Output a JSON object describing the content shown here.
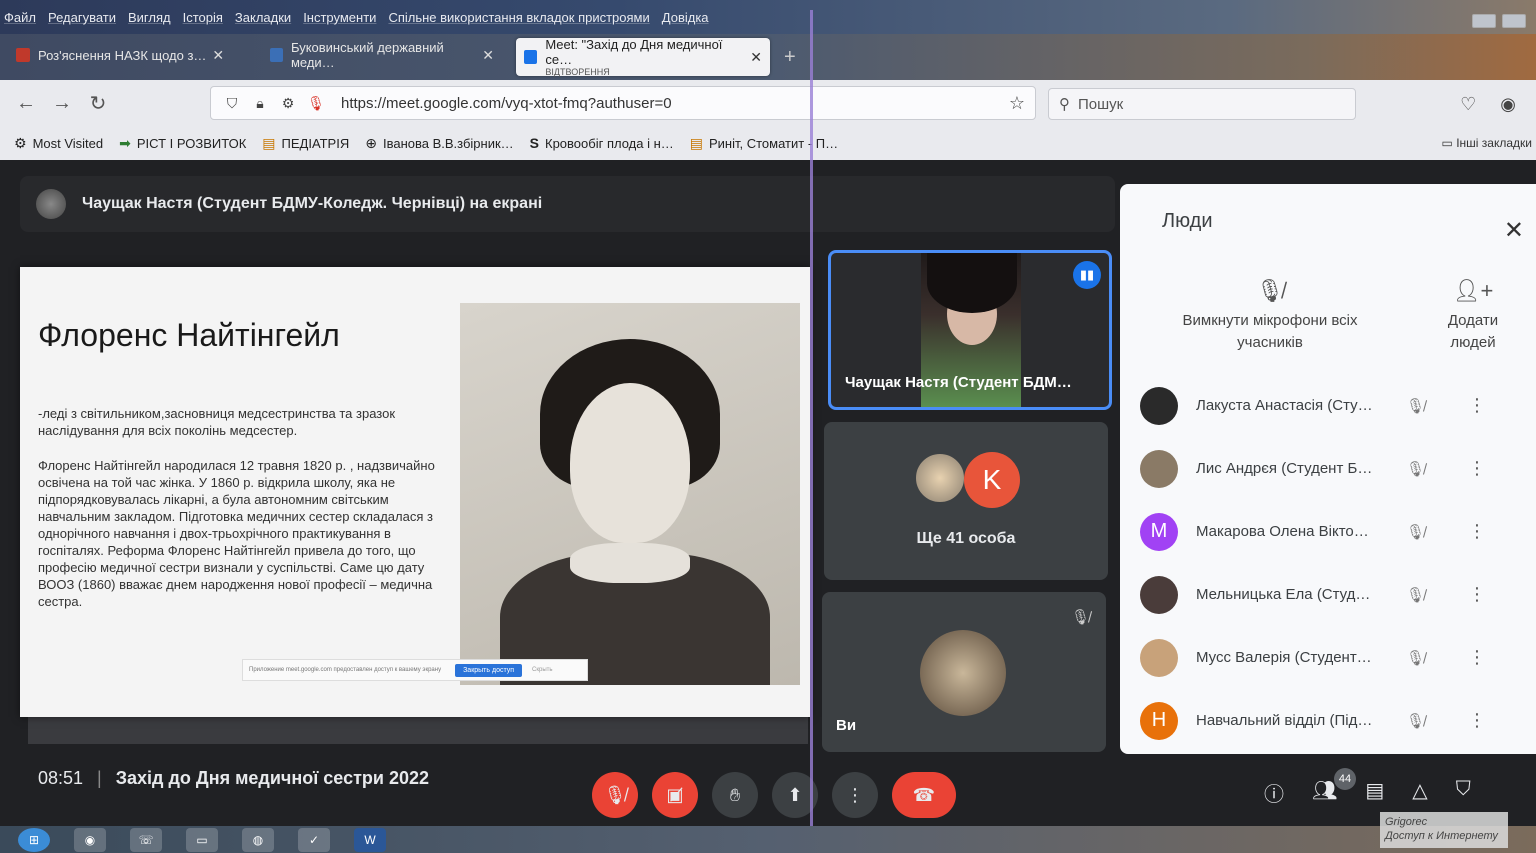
{
  "menu": [
    "Файл",
    "Редагувати",
    "Вигляд",
    "Історія",
    "Закладки",
    "Інструменти",
    "Спільне використання вкладок пристроями",
    "Довідка"
  ],
  "tabs": [
    {
      "label": "Роз'яснення НАЗК щодо з…",
      "favicon_color": "#c0392b"
    },
    {
      "label": "Буковинський державний меди…",
      "favicon_color": "#3b6fb6"
    },
    {
      "label": "Meet: \"Захід до Дня медичної се…",
      "sub": "ВІДТВОРЕННЯ",
      "favicon_color": "#1a73e8"
    }
  ],
  "url": "https://meet.google.com/vyq-xtot-fmq?authuser=0",
  "search_placeholder": "Пошук",
  "bookmarks": [
    {
      "label": "Most Visited",
      "icon": "gear-icon"
    },
    {
      "label": "РІСТ І РОЗВИТОК",
      "icon": "arrow-icon"
    },
    {
      "label": "ПЕДІАТРІЯ",
      "icon": "book-icon"
    },
    {
      "label": "Іванова В.В.збірник…",
      "icon": "globe-icon"
    },
    {
      "label": "Кровообіг плода і н…",
      "icon": "s-icon"
    },
    {
      "label": "Риніт, Стоматит - П…",
      "icon": "book-icon"
    }
  ],
  "bookmarks_other": "Інші закладки",
  "presenter_text": "Чаущак Настя (Студент БДМУ-Коледж. Чернівці) на екрані",
  "slide": {
    "title": "Флоренс Найтінгейл",
    "para1": "-леді з світильником,засновниця медсестринства та зразок наслідування для всіх поколінь медсестер.",
    "para2": "Флоренс Найтінгейл народилася 12 травня 1820 р. , надзвичайно освічена на той час жінка. У 1860 р. відкрила школу, яка не підпорядковувалась лікарні, а була автономним світським навчальним закладом. Підготовка медичних сестер складалася з однорічного навчання і двох-трьохрічного практикування в госпіталях. Реформа Флоренс Найтінгейл привела до того, що професію медичної сестри визнали у суспільстві. Саме цю дату ВООЗ (1860) вважає днем народження нової професії – медична сестра.",
    "share_notice": "Приложение meet.google.com предоставлен доступ к вашему экрану",
    "share_button": "Закрыть доступ",
    "share_hide": "Скрыть"
  },
  "tiles": {
    "presenter_name": "Чаущак Настя (Студент БДМ…",
    "others_initial": "K",
    "others_label": "Ще 41 особа",
    "self_label": "Ви"
  },
  "people": {
    "title": "Люди",
    "mute_all": "Вимкнути мікрофони всіх учасників",
    "add_people": "Додати людей",
    "list": [
      {
        "name": "Лакуста Анастасія (Сту…",
        "initial": "",
        "color": "#2a2a2a"
      },
      {
        "name": "Лис Андрєя (Студент Б…",
        "initial": "",
        "color": "#8a7a66"
      },
      {
        "name": "Макарова Олена Вікто…",
        "initial": "M",
        "color": "#a142f4"
      },
      {
        "name": "Мельницька Ела (Студ…",
        "initial": "",
        "color": "#4a3c3a"
      },
      {
        "name": "Мусс Валерія (Студент…",
        "initial": "",
        "color": "#c8a27a"
      },
      {
        "name": "Навчальний відділ (Під…",
        "initial": "H",
        "color": "#e8710a"
      }
    ]
  },
  "bottom": {
    "time": "08:51",
    "meeting_title": "Захід до Дня медичної сестри 2022",
    "participants_count": "44"
  },
  "tooltip": {
    "user": "Grigorec",
    "status": "Доступ к Интернету"
  }
}
